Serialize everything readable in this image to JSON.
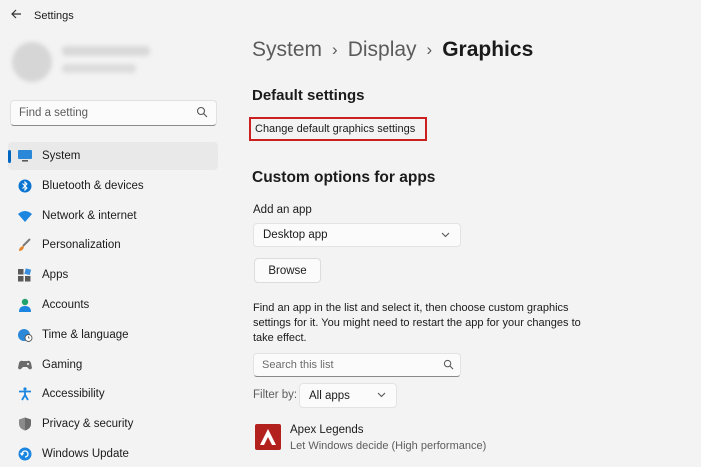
{
  "window": {
    "title": "Settings"
  },
  "sidebar": {
    "search_placeholder": "Find a setting",
    "items": [
      {
        "label": "System",
        "icon": "monitor-icon",
        "active": true
      },
      {
        "label": "Bluetooth & devices",
        "icon": "bluetooth-icon"
      },
      {
        "label": "Network & internet",
        "icon": "wifi-icon"
      },
      {
        "label": "Personalization",
        "icon": "brush-icon"
      },
      {
        "label": "Apps",
        "icon": "apps-icon"
      },
      {
        "label": "Accounts",
        "icon": "person-icon"
      },
      {
        "label": "Time & language",
        "icon": "globe-clock-icon"
      },
      {
        "label": "Gaming",
        "icon": "gamepad-icon"
      },
      {
        "label": "Accessibility",
        "icon": "accessibility-icon"
      },
      {
        "label": "Privacy & security",
        "icon": "shield-icon"
      },
      {
        "label": "Windows Update",
        "icon": "update-icon"
      }
    ]
  },
  "breadcrumb": {
    "items": [
      "System",
      "Display"
    ],
    "current": "Graphics"
  },
  "main": {
    "default_settings_heading": "Default settings",
    "change_default_link": "Change default graphics settings",
    "custom_heading": "Custom options for apps",
    "add_app_label": "Add an app",
    "app_type_selected": "Desktop app",
    "browse_button": "Browse",
    "instructions": "Find an app in the list and select it, then choose custom graphics settings for it. You might need to restart the app for your changes to take effect.",
    "list_search_placeholder": "Search this list",
    "filter_label": "Filter by:",
    "filter_selected": "All apps",
    "apps": [
      {
        "name": "Apex Legends",
        "setting": "Let Windows decide (High performance)"
      }
    ]
  },
  "colors": {
    "accent": "#0067c0",
    "highlight_border": "#cc1f1f",
    "app_icon_bg": "#b3211e"
  }
}
